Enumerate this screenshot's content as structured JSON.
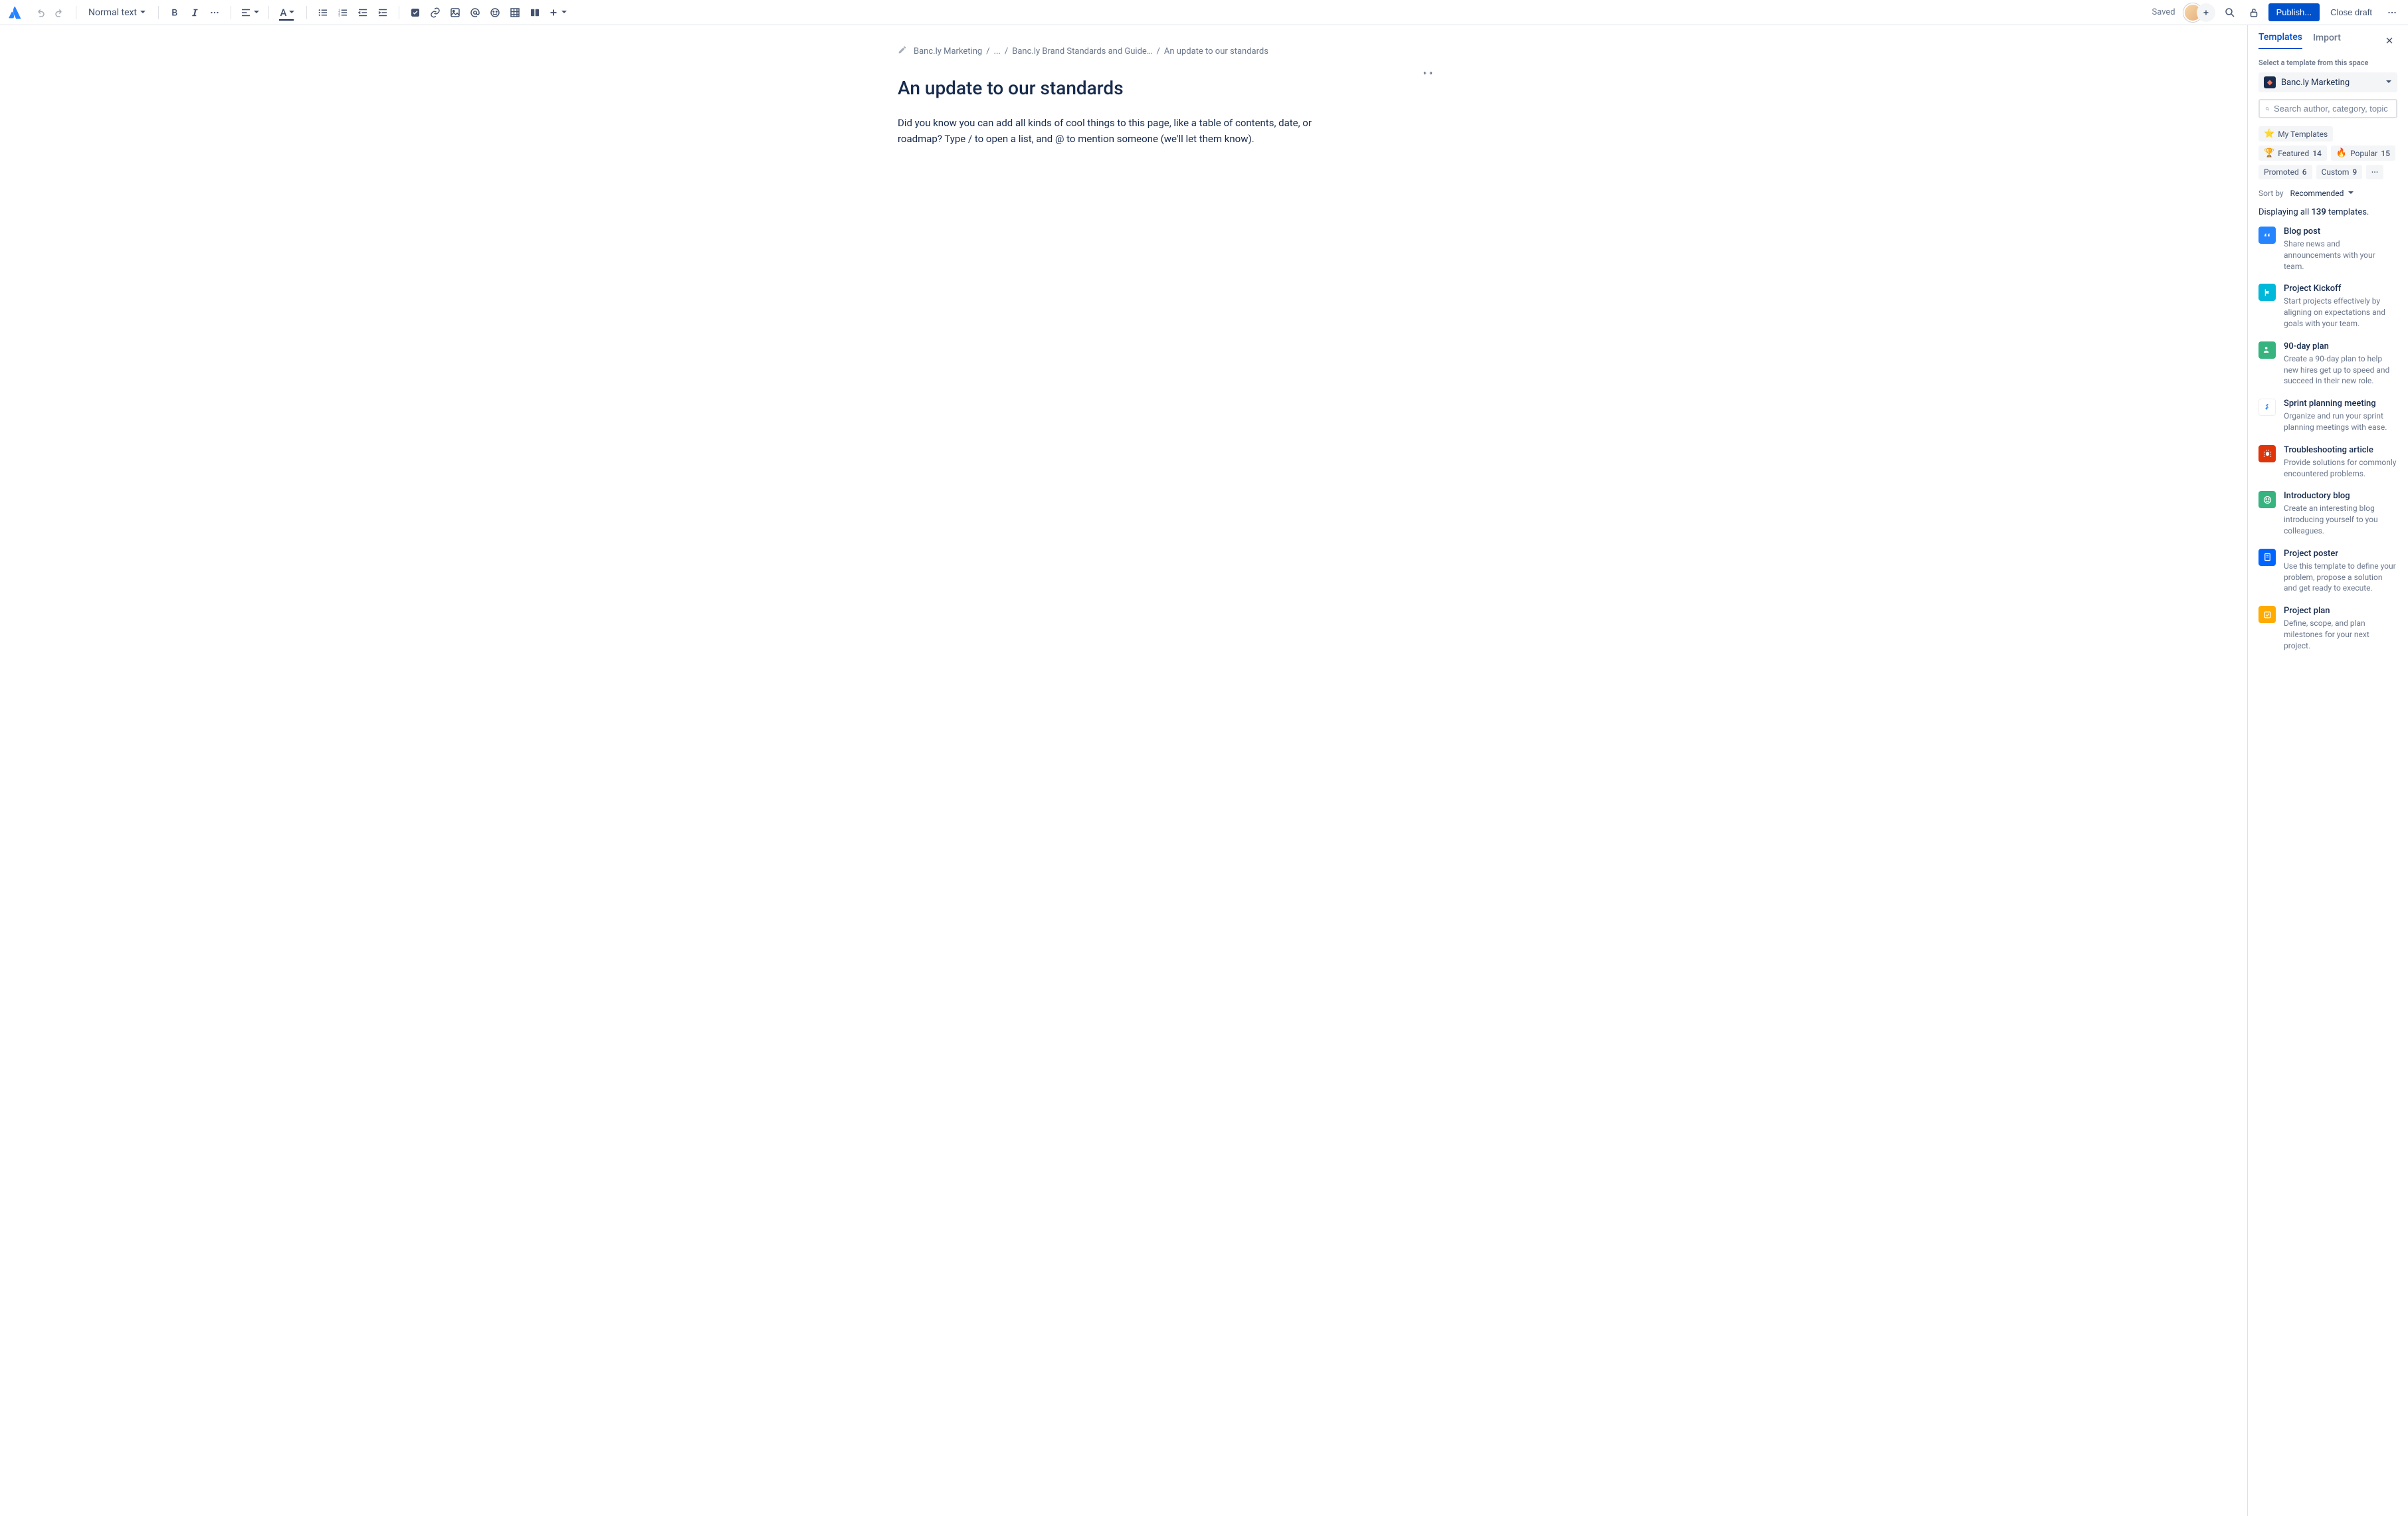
{
  "toolbar": {
    "text_style": "Normal text",
    "saved_label": "Saved",
    "publish_label": "Publish...",
    "close_draft_label": "Close draft"
  },
  "breadcrumb": {
    "items": [
      "Banc.ly Marketing",
      "...",
      "Banc.ly Brand Standards and Guide…",
      "An update to our standards"
    ]
  },
  "page": {
    "title": "An update to our standards",
    "body": "Did you know you can add all kinds of cool things to this page, like a table of contents, date, or roadmap? Type / to open a list, and @ to mention someone (we'll let them know)."
  },
  "panel": {
    "tabs": {
      "templates": "Templates",
      "import": "Import"
    },
    "select_label": "Select a template from this space",
    "space_name": "Banc.ly Marketing",
    "search_placeholder": "Search author, category, topic",
    "chips": [
      {
        "emoji": "⭐",
        "label": "My Templates",
        "count": ""
      },
      {
        "emoji": "🏆",
        "label": "Featured",
        "count": "14"
      },
      {
        "emoji": "🔥",
        "label": "Popular",
        "count": "15"
      },
      {
        "emoji": "",
        "label": "Promoted",
        "count": "6"
      },
      {
        "emoji": "",
        "label": "Custom",
        "count": "9"
      }
    ],
    "sort_label": "Sort by",
    "sort_value": "Recommended",
    "displaying_prefix": "Displaying all ",
    "displaying_count": "139",
    "displaying_suffix": " templates.",
    "templates": [
      {
        "title": "Blog post",
        "desc": "Share news and announcements with your team.",
        "color": "ic-blue",
        "icon": "quote"
      },
      {
        "title": "Project Kickoff",
        "desc": "Start projects effectively by aligning on expectations and goals with your team.",
        "color": "ic-teal",
        "icon": "flag"
      },
      {
        "title": "90-day plan",
        "desc": "Create a 90-day plan to help new hires get up to speed and succeed in their new role.",
        "color": "ic-green",
        "icon": "person"
      },
      {
        "title": "Sprint planning meeting",
        "desc": "Organize and run your sprint planning meetings with ease.",
        "color": "ic-white",
        "icon": "jira"
      },
      {
        "title": "Troubleshooting article",
        "desc": "Provide solutions for commonly encountered problems.",
        "color": "ic-red",
        "icon": "bug"
      },
      {
        "title": "Introductory blog",
        "desc": "Create an interesting blog introducing yourself to you colleagues.",
        "color": "ic-green",
        "icon": "smile"
      },
      {
        "title": "Project poster",
        "desc": "Use this template to define your problem, propose a solution and get ready to execute.",
        "color": "ic-darker-blue",
        "icon": "poster"
      },
      {
        "title": "Project plan",
        "desc": "Define, scope, and plan milestones for your next project.",
        "color": "ic-yellow",
        "icon": "check"
      }
    ]
  }
}
